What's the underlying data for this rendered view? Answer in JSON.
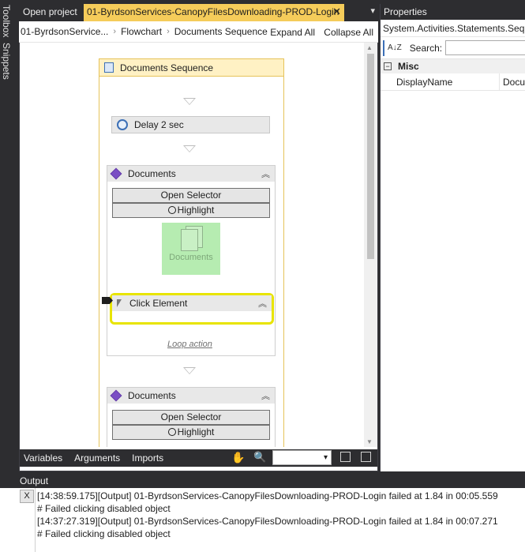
{
  "side_tabs": [
    "Toolbox",
    "Snippets"
  ],
  "tabs": {
    "open_project": "Open project",
    "active": "01-ByrdsonServices-CanopyFilesDownloading-PROD-Login",
    "close": "✕",
    "dropdown": "▾"
  },
  "breadcrumb": [
    "01-ByrdsonService...",
    "Flowchart",
    "Documents Sequence"
  ],
  "breadcrumb_sep": "›",
  "toolbar": {
    "expand_all": "Expand All",
    "collapse_all": "Collapse All"
  },
  "sequence": {
    "title": "Documents Sequence"
  },
  "activities": {
    "delay": "Delay 2 sec",
    "documents1": {
      "title": "Documents",
      "open_selector": "Open Selector",
      "highlight": "Highlight",
      "tile": "Documents"
    },
    "click": {
      "title": "Click Element"
    },
    "loop": "Loop action",
    "documents2": {
      "title": "Documents",
      "open_selector": "Open Selector",
      "highlight": "Highlight"
    }
  },
  "bottom": {
    "variables": "Variables",
    "arguments": "Arguments",
    "imports": "Imports",
    "zoom_dd": "▾"
  },
  "properties": {
    "title": "Properties",
    "type": "System.Activities.Statements.Seque",
    "search_label": "Search:",
    "category": "Misc",
    "rows": [
      {
        "name": "DisplayName",
        "value": "Docu"
      }
    ]
  },
  "output": {
    "title": "Output",
    "clear": "X",
    "lines": [
      "[14:38:59.175][Output] 01-ByrdsonServices-CanopyFilesDownloading-PROD-Login failed at 1.84 in 00:05.559",
      "# Failed clicking disabled object",
      "[14:37:27.319][Output] 01-ByrdsonServices-CanopyFilesDownloading-PROD-Login failed at 1.84 in 00:07.271",
      "# Failed clicking disabled object"
    ]
  },
  "colors": {
    "accent_tab": "#f5cc5a",
    "highlight_border": "#e8e400",
    "dark_chrome": "#2d2d30"
  },
  "icons": [
    "sequence-icon",
    "clock-icon",
    "gem-icon",
    "chevron-up-icon",
    "cursor-icon",
    "magnifier-icon",
    "hand-icon",
    "document-icon",
    "breakpoint-icon"
  ]
}
